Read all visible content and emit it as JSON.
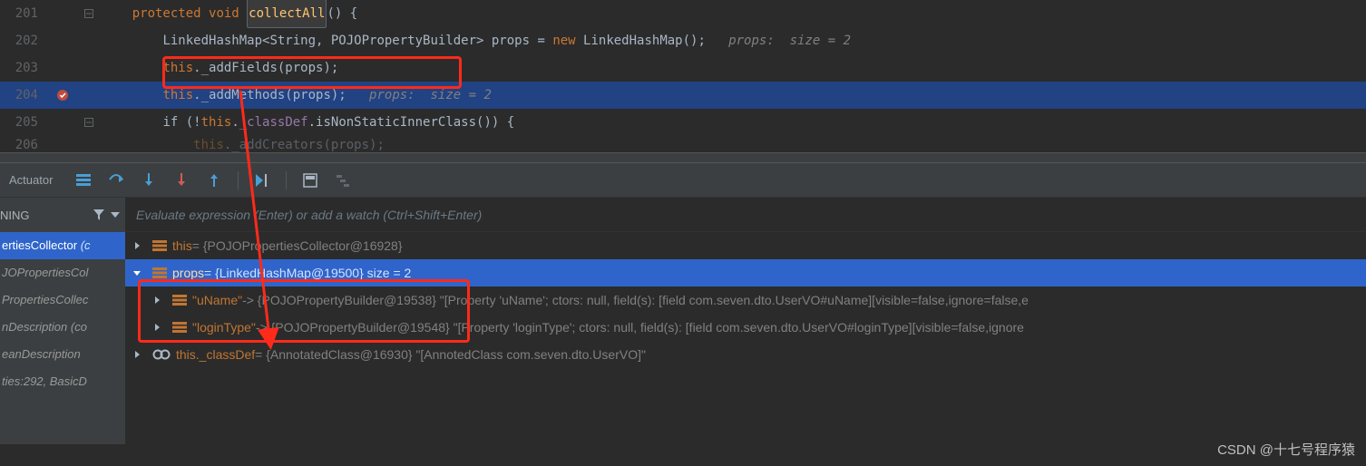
{
  "gutter": {
    "lines": [
      "201",
      "202",
      "203",
      "204",
      "205",
      "206"
    ]
  },
  "code": {
    "l201": {
      "kw1": "protected ",
      "kw2": "void ",
      "method": "collectAll",
      "rest": "() {"
    },
    "l202": {
      "indent": "        ",
      "t1": "LinkedHashMap<String, POJOPropertyBuilder> props = ",
      "kw": "new ",
      "t2": "LinkedHashMap();   ",
      "c": "props:  size = 2"
    },
    "l203": {
      "indent": "        ",
      "kw": "this",
      "t": "._addFields(props);"
    },
    "l204": {
      "indent": "        ",
      "kw": "this",
      "t": "._addMethods(props);   ",
      "c": "props:  size = 2"
    },
    "l205": {
      "indent": "        ",
      "t1": "if (!",
      "kw": "this",
      "t2": ".",
      "f": "_classDef",
      "t3": ".isNonStaticInnerClass()) {"
    },
    "l206": {
      "indent": "            ",
      "kw": "this",
      "t": "._addCreators(props);"
    }
  },
  "toolbar": {
    "actuator": "Actuator"
  },
  "frames": {
    "header": "NING",
    "items": [
      {
        "text": "ertiesCollector",
        "pkg": " (c",
        "sel": true
      },
      {
        "text": "JOPropertiesCol",
        "pkg": "",
        "sel": false
      },
      {
        "text": "PropertiesCollec",
        "pkg": "",
        "sel": false
      },
      {
        "text": "nDescription ",
        "pkg": "(co",
        "sel": false
      },
      {
        "text": "eanDescription",
        "pkg": "",
        "sel": false
      },
      {
        "text": "ties:292, BasicD",
        "pkg": "",
        "sel": false
      }
    ]
  },
  "eval_placeholder": "Evaluate expression (Enter) or add a watch (Ctrl+Shift+Enter)",
  "vars": [
    {
      "exp": ">",
      "ic": "bars",
      "name": "this",
      "rest": " = {POJOPropertiesCollector@16928}",
      "sel": false,
      "indent": 0
    },
    {
      "exp": "v",
      "ic": "bars",
      "name": "props",
      "rest": " = {LinkedHashMap@19500}  size = 2",
      "sel": true,
      "indent": 0
    },
    {
      "exp": ">",
      "ic": "bars",
      "name": "\"uName\"",
      "rest": " -> {POJOPropertyBuilder@19538} \"[Property 'uName'; ctors: null, field(s): [field com.seven.dto.UserVO#uName][visible=false,ignore=false,e",
      "sel": false,
      "indent": 1
    },
    {
      "exp": ">",
      "ic": "bars",
      "name": "\"loginType\"",
      "rest": " -> {POJOPropertyBuilder@19548} \"[Property 'loginType'; ctors: null, field(s): [field com.seven.dto.UserVO#loginType][visible=false,ignore",
      "sel": false,
      "indent": 1
    },
    {
      "exp": ">",
      "ic": "oo",
      "name": "this._classDef",
      "rest": " = {AnnotatedClass@16930} \"[AnnotedClass com.seven.dto.UserVO]\"",
      "sel": false,
      "indent": 0
    }
  ],
  "watermark": "CSDN @十七号程序猿"
}
